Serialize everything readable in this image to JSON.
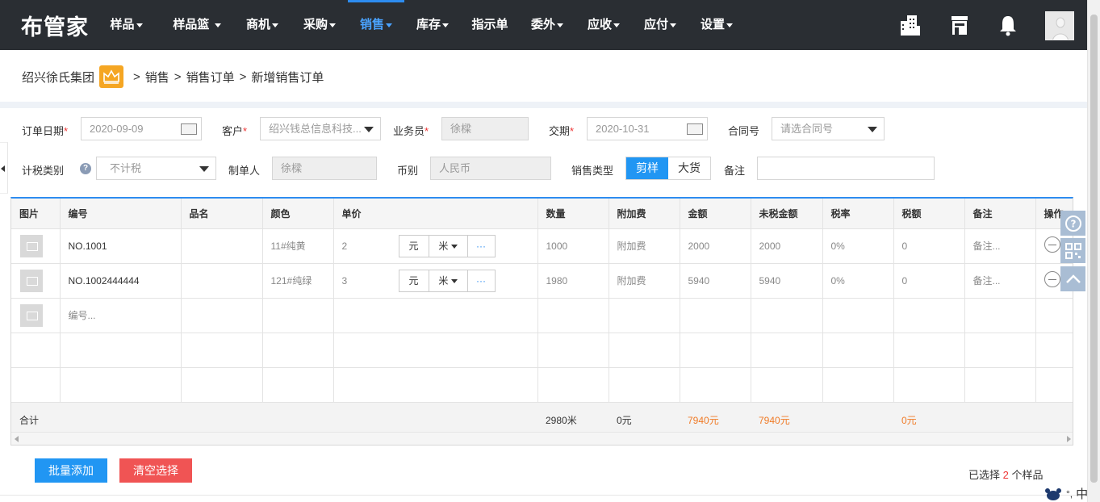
{
  "app": {
    "logo": "布管家"
  },
  "nav": [
    {
      "label": "样品",
      "caret": true
    },
    {
      "label": "样品篮",
      "caret": true
    },
    {
      "label": "商机",
      "caret": true
    },
    {
      "label": "采购",
      "caret": true
    },
    {
      "label": "销售",
      "caret": true,
      "active": true
    },
    {
      "label": "库存",
      "caret": true
    },
    {
      "label": "指示单",
      "caret": false
    },
    {
      "label": "委外",
      "caret": true
    },
    {
      "label": "应收",
      "caret": true
    },
    {
      "label": "应付",
      "caret": true
    },
    {
      "label": "设置",
      "caret": true
    }
  ],
  "topicons": [
    "building-icon",
    "store-icon",
    "bell-icon",
    "avatar"
  ],
  "breadcrumb": {
    "company": "绍兴徐氏集团",
    "sep": ">",
    "items": [
      "销售",
      "销售订单",
      "新增销售订单"
    ]
  },
  "form": {
    "order_date": {
      "label": "订单日期",
      "value": "2020-09-09"
    },
    "customer": {
      "label": "客户",
      "value": "绍兴钱总信息科技..."
    },
    "salesman": {
      "label": "业务员",
      "value": "徐樑"
    },
    "delivery": {
      "label": "交期",
      "value": "2020-10-31"
    },
    "contract": {
      "label": "合同号",
      "placeholder": "请选合同号"
    },
    "tax_type": {
      "label": "计税类别",
      "value": "不计税",
      "help": "?"
    },
    "maker": {
      "label": "制单人",
      "value": "徐樑"
    },
    "currency": {
      "label": "币别",
      "value": "人民币"
    },
    "sale_type": {
      "label": "销售类型",
      "options": [
        "剪样",
        "大货"
      ],
      "selected": "剪样"
    },
    "remark": {
      "label": "备注",
      "value": ""
    }
  },
  "table": {
    "headers": [
      "图片",
      "编号",
      "品名",
      "颜色",
      "单价",
      "数量",
      "附加费",
      "金额",
      "未税金额",
      "税率",
      "税额",
      "备注",
      "操作"
    ],
    "rows": [
      {
        "code": "NO.1001",
        "name": "",
        "color": "11#纯黄",
        "price": "2",
        "cur": "元",
        "unit": "米",
        "more": "···",
        "qty": "1000",
        "extra": "附加费",
        "amount": "2000",
        "notax": "2000",
        "rate": "0%",
        "tax": "0",
        "remark": "备注..."
      },
      {
        "code": "NO.1002444444",
        "name": "",
        "color": "121#纯绿",
        "price": "3",
        "cur": "元",
        "unit": "米",
        "more": "···",
        "qty": "1980",
        "extra": "附加费",
        "amount": "5940",
        "notax": "5940",
        "rate": "0%",
        "tax": "0",
        "remark": "备注..."
      }
    ],
    "new_row_placeholder": "编号...",
    "summary": {
      "label": "合计",
      "qty": "2980米",
      "extra": "0元",
      "amount": "7940元",
      "notax": "7940元",
      "tax": "0元"
    }
  },
  "footer": {
    "batch_add": "批量添加",
    "clear": "清空选择",
    "selected_prefix": "已选择",
    "selected_count": "2",
    "selected_suffix": "个样品"
  },
  "colors": {
    "topbar": "#2a2e33",
    "active": "#2d8cf0",
    "primary": "#2196f3",
    "danger": "#f05454",
    "orange": "#f07a25"
  },
  "ime": {
    "label": "中"
  }
}
